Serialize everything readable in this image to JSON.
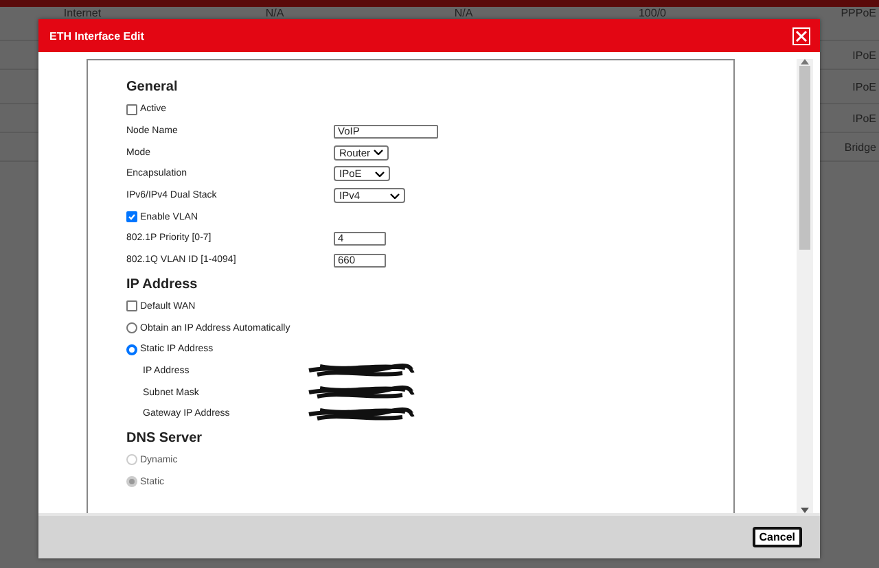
{
  "background_table": {
    "rows": [
      {
        "column_1": "Internet",
        "column_2": "N/A",
        "column_3": "N/A",
        "column_4": "100/0",
        "column_5": "PPPoE"
      },
      {
        "column_5": "IPoE"
      },
      {
        "column_5": "IPoE"
      },
      {
        "column_5": "IPoE"
      },
      {
        "column_5": "Bridge"
      }
    ]
  },
  "dialog": {
    "title": "ETH Interface Edit",
    "sections": [
      {
        "heading": "General",
        "items": [
          {
            "kind": "checkbox",
            "label": "Active",
            "checked": false
          },
          {
            "kind": "text",
            "label": "Node Name",
            "value": "VoIP"
          },
          {
            "kind": "select",
            "label": "Mode",
            "value": "Router"
          },
          {
            "kind": "select",
            "label": "Encapsulation",
            "value": "IPoE"
          },
          {
            "kind": "select",
            "label": "IPv6/IPv4 Dual Stack",
            "value": "IPv4"
          },
          {
            "kind": "checkbox",
            "label": "Enable VLAN",
            "checked": true
          },
          {
            "kind": "number",
            "label": "802.1P Priority [0-7]",
            "value": "4"
          },
          {
            "kind": "number",
            "label": "802.1Q VLAN ID [1-4094]",
            "value": "660"
          }
        ]
      },
      {
        "heading": "IP Address",
        "items": [
          {
            "kind": "checkbox",
            "label": "Default WAN",
            "checked": false
          },
          {
            "kind": "radio",
            "label": "Obtain an IP Address Automatically",
            "selected": false,
            "disabled": false
          },
          {
            "kind": "radio",
            "label": "Static IP Address",
            "selected": true,
            "disabled": false
          },
          {
            "kind": "masked",
            "label": "IP Address"
          },
          {
            "kind": "masked",
            "label": "Subnet Mask"
          },
          {
            "kind": "masked",
            "label": "Gateway IP Address"
          }
        ]
      },
      {
        "heading": "DNS Server",
        "items": [
          {
            "kind": "radio",
            "label": "Dynamic",
            "selected": false,
            "disabled": true
          },
          {
            "kind": "radio",
            "label": "Static",
            "selected": true,
            "disabled": true
          }
        ]
      }
    ],
    "buttons": [
      "Cancel"
    ]
  }
}
